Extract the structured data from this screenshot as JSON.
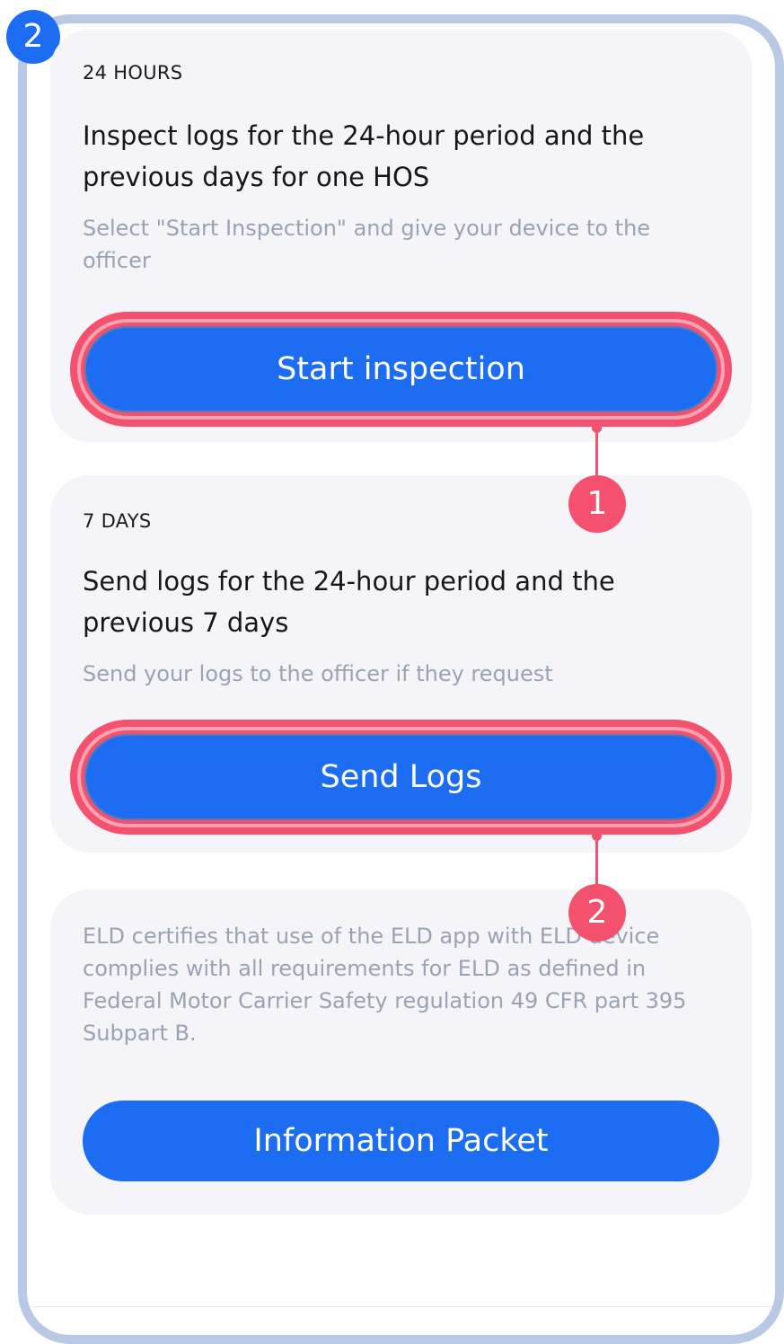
{
  "step_badge": "2",
  "card_24h": {
    "eyebrow": "24 HOURS",
    "heading": "Inspect logs for the 24-hour period and the previous days for one HOS",
    "description": "Select \"Start Inspection\" and give your device to the officer",
    "button_label": "Start inspection"
  },
  "card_7d": {
    "eyebrow": "7 DAYS",
    "heading": "Send logs for the 24-hour period and the previous 7 days",
    "description": "Send your logs to the officer if they request",
    "button_label": "Send Logs"
  },
  "card_info": {
    "description": "ELD certifies that use of the ELD app with ELD device complies with all requirements for ELD as defined in Federal Motor Carrier Safety regulation 49 CFR part 395 Subpart B.",
    "button_label": "Information Packet"
  },
  "callouts": [
    {
      "label": "1"
    },
    {
      "label": "2"
    }
  ],
  "colors": {
    "primary_button": "#1c6df2",
    "highlight": "#f4516f",
    "frame_border": "#b9c9e5",
    "card_background": "#f4f4f9",
    "muted_text": "#9aa3b4"
  }
}
